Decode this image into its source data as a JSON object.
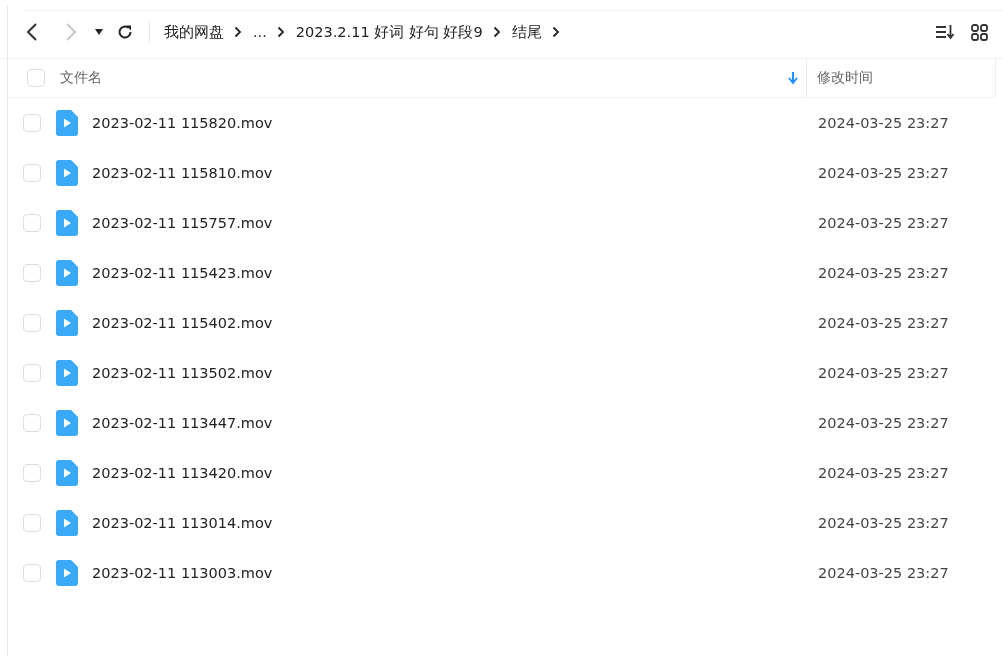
{
  "toolbar": {
    "back": {
      "disabled": false
    },
    "forward": {
      "disabled": true
    }
  },
  "breadcrumb": [
    {
      "label": "我的网盘"
    },
    {
      "label": "..."
    },
    {
      "label": "2023.2.11 好词 好句 好段9"
    },
    {
      "label": "结尾"
    }
  ],
  "select_all": {
    "checked": false
  },
  "columns": [
    {
      "label": "文件名",
      "sorted": true
    },
    {
      "label": "修改时间",
      "sorted": false
    }
  ],
  "files": [
    {
      "name": "2023-02-11 115820.mov",
      "modified": "2024-03-25 23:27",
      "checked": false
    },
    {
      "name": "2023-02-11 115810.mov",
      "modified": "2024-03-25 23:27",
      "checked": false
    },
    {
      "name": "2023-02-11 115757.mov",
      "modified": "2024-03-25 23:27",
      "checked": false
    },
    {
      "name": "2023-02-11 115423.mov",
      "modified": "2024-03-25 23:27",
      "checked": false
    },
    {
      "name": "2023-02-11 115402.mov",
      "modified": "2024-03-25 23:27",
      "checked": false
    },
    {
      "name": "2023-02-11 113502.mov",
      "modified": "2024-03-25 23:27",
      "checked": false
    },
    {
      "name": "2023-02-11 113447.mov",
      "modified": "2024-03-25 23:27",
      "checked": false
    },
    {
      "name": "2023-02-11 113420.mov",
      "modified": "2024-03-25 23:27",
      "checked": false
    },
    {
      "name": "2023-02-11 113014.mov",
      "modified": "2024-03-25 23:27",
      "checked": false
    },
    {
      "name": "2023-02-11 113003.mov",
      "modified": "2024-03-25 23:27",
      "checked": false
    }
  ]
}
